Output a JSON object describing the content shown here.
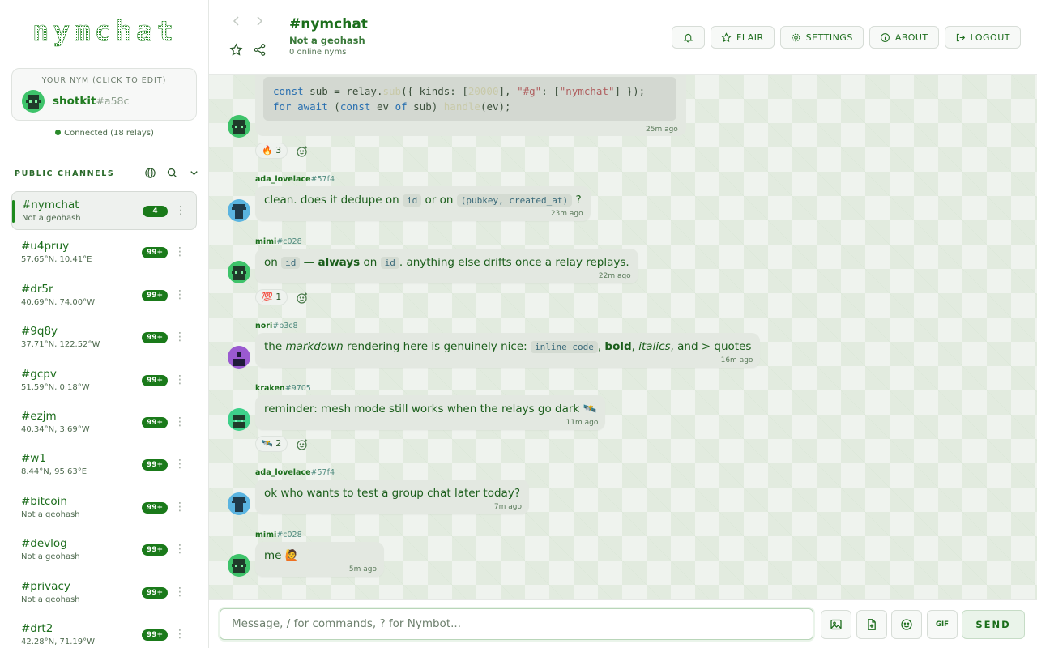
{
  "app": {
    "logo_text": "nymchat"
  },
  "sidebar": {
    "nym_caption": "YOUR NYM (CLICK TO EDIT)",
    "nym_name": "shotkit",
    "nym_suffix": "#a58c",
    "connection": "Connected (18 relays)",
    "section_title": "PUBLIC CHANNELS",
    "channels": [
      {
        "name": "#nymchat",
        "sub": "Not a geohash",
        "badge": "4",
        "active": true
      },
      {
        "name": "#u4pruy",
        "sub": "57.65°N, 10.41°E",
        "badge": "99+"
      },
      {
        "name": "#dr5r",
        "sub": "40.69°N, 74.00°W",
        "badge": "99+"
      },
      {
        "name": "#9q8y",
        "sub": "37.71°N, 122.52°W",
        "badge": "99+"
      },
      {
        "name": "#gcpv",
        "sub": "51.59°N, 0.18°W",
        "badge": "99+"
      },
      {
        "name": "#ezjm",
        "sub": "40.34°N, 3.69°W",
        "badge": "99+"
      },
      {
        "name": "#w1",
        "sub": "8.44°N, 95.63°E",
        "badge": "99+"
      },
      {
        "name": "#bitcoin",
        "sub": "Not a geohash",
        "badge": "99+"
      },
      {
        "name": "#devlog",
        "sub": "Not a geohash",
        "badge": "99+"
      },
      {
        "name": "#privacy",
        "sub": "Not a geohash",
        "badge": "99+"
      },
      {
        "name": "#drt2",
        "sub": "42.28°N, 71.19°W",
        "badge": "99+"
      }
    ]
  },
  "header": {
    "title": "#nymchat",
    "subtitle": "Not a geohash",
    "online": "0 online nyms",
    "buttons": {
      "flair": "FLAIR",
      "settings": "SETTINGS",
      "about": "ABOUT",
      "logout": "LOGOUT"
    }
  },
  "messages": {
    "m0": {
      "code_l1": {
        "a": "const",
        "b": " sub = relay.",
        "c": "sub",
        "d": "({ kinds: [",
        "e": "20000",
        "f": "], ",
        "g": "\"#g\"",
        "h": ": [",
        "i": "\"nymchat\"",
        "j": "] });"
      },
      "code_l2": {
        "a": "for",
        "b": " ",
        "c": "await",
        "d": " (",
        "e": "const",
        "f": " ev ",
        "g": "of",
        "h": " sub) ",
        "i": "handle",
        "j": "(ev);"
      },
      "time": "25m ago",
      "reaction": "🔥 3"
    },
    "m1": {
      "author": "ada_lovelace",
      "tag": "#57f4",
      "t1": "clean. does it dedupe on ",
      "c1": "id",
      "t2": " or on ",
      "c2": "(pubkey, created_at)",
      "t3": " ?",
      "time": "23m ago"
    },
    "m2": {
      "author": "mimi",
      "tag": "#c028",
      "t1": "on ",
      "c1": "id",
      "t2": " — ",
      "b1": "always",
      "t3": " on ",
      "c2": "id",
      "t4": ". anything else drifts once a relay replays.",
      "time": "22m ago",
      "reaction": "💯 1"
    },
    "m3": {
      "author": "nori",
      "tag": "#b3c8",
      "t1": "the ",
      "i1": "markdown",
      "t2": " rendering here is genuinely nice: ",
      "c1": "inline code",
      "t3": ", ",
      "b1": "bold",
      "t4": ", ",
      "i2": "italics",
      "t5": ", and > quotes",
      "time": "16m ago"
    },
    "m4": {
      "author": "kraken",
      "tag": "#9705",
      "text": "reminder: mesh mode still works when the relays go dark 🛰️",
      "time": "11m ago",
      "reaction": "🛰️ 2"
    },
    "m5": {
      "author": "ada_lovelace",
      "tag": "#57f4",
      "text": "ok who wants to test a group chat later today?",
      "time": "7m ago"
    },
    "m6": {
      "author": "mimi",
      "tag": "#c028",
      "text": "me 🙋",
      "time": "5m ago"
    }
  },
  "composer": {
    "placeholder": "Message, / for commands, ? for Nymbot...",
    "gif_label": "GIF",
    "send_label": "SEND"
  },
  "colors": {
    "accent": "#1b6e1b",
    "badge": "#1a7a1a",
    "bubble": "#e3e8e1"
  }
}
